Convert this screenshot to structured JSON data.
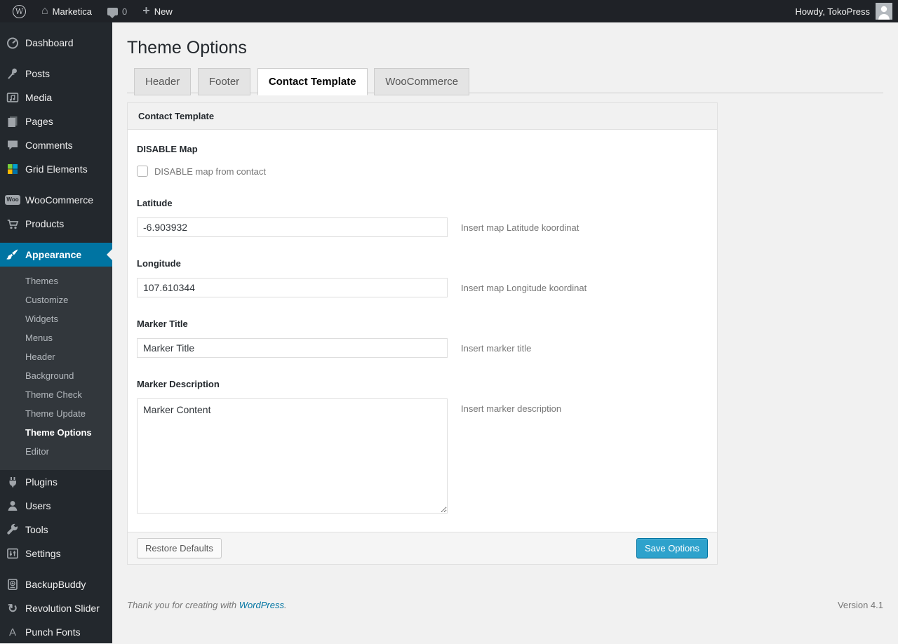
{
  "admin_bar": {
    "wp_logo_glyph": "W",
    "site_name": "Marketica",
    "comments_count": "0",
    "new_label": "New",
    "howdy_label": "Howdy, TokoPress"
  },
  "sidebar": {
    "items": [
      {
        "label": "Dashboard",
        "icon": "dashboard-icon"
      },
      {
        "label": "Posts",
        "icon": "pin-icon"
      },
      {
        "label": "Media",
        "icon": "media-icon"
      },
      {
        "label": "Pages",
        "icon": "pages-icon"
      },
      {
        "label": "Comments",
        "icon": "comment-icon"
      },
      {
        "label": "Grid Elements",
        "icon": "grid-elements-icon"
      },
      {
        "label": "WooCommerce",
        "icon": "woocommerce-icon",
        "badge_text": "Woo"
      },
      {
        "label": "Products",
        "icon": "cart-icon"
      },
      {
        "label": "Appearance",
        "icon": "brush-icon",
        "active": true
      },
      {
        "label": "Plugins",
        "icon": "plug-icon"
      },
      {
        "label": "Users",
        "icon": "user-icon"
      },
      {
        "label": "Tools",
        "icon": "wrench-icon"
      },
      {
        "label": "Settings",
        "icon": "settings-icon"
      },
      {
        "label": "BackupBuddy",
        "icon": "backup-drive-icon"
      },
      {
        "label": "Revolution Slider",
        "icon": "refresh-icon",
        "glyph": "↻"
      },
      {
        "label": "Punch Fonts",
        "icon": "letter-a-icon",
        "glyph": "A"
      }
    ],
    "appearance_submenu": {
      "items": [
        "Themes",
        "Customize",
        "Widgets",
        "Menus",
        "Header",
        "Background",
        "Theme Check",
        "Theme Update",
        "Theme Options",
        "Editor"
      ],
      "current": "Theme Options"
    }
  },
  "page": {
    "title": "Theme Options",
    "tabs": [
      {
        "label": "Header",
        "active": false
      },
      {
        "label": "Footer",
        "active": false
      },
      {
        "label": "Contact Template",
        "active": true
      },
      {
        "label": "WooCommerce",
        "active": false
      }
    ],
    "panel": {
      "title": "Contact Template",
      "fields": [
        {
          "type": "checkbox",
          "label": "DISABLE Map",
          "checkbox_label": "DISABLE map from contact",
          "checked": false
        },
        {
          "type": "text",
          "label": "Latitude",
          "value": "-6.903932",
          "hint": "Insert map Latitude koordinat"
        },
        {
          "type": "text",
          "label": "Longitude",
          "value": "107.610344",
          "hint": "Insert map Longitude koordinat"
        },
        {
          "type": "text",
          "label": "Marker Title",
          "value": "Marker Title",
          "hint": "Insert marker title"
        },
        {
          "type": "textarea",
          "label": "Marker Description",
          "value": "Marker Content",
          "hint": "Insert marker description"
        }
      ],
      "buttons": {
        "restore": "Restore Defaults",
        "save": "Save Options"
      }
    },
    "footer": {
      "thanks_prefix": "Thank you for creating with ",
      "link_text": "WordPress",
      "suffix": ".",
      "version": "Version 4.1"
    }
  },
  "colors": {
    "admin_bar_bg": "#1f2227",
    "menu_bg": "#23282d",
    "submenu_bg": "#32373c",
    "menu_highlight": "#0074a2",
    "button_primary": "#2ea2cc",
    "page_bg": "#f1f1f1"
  }
}
